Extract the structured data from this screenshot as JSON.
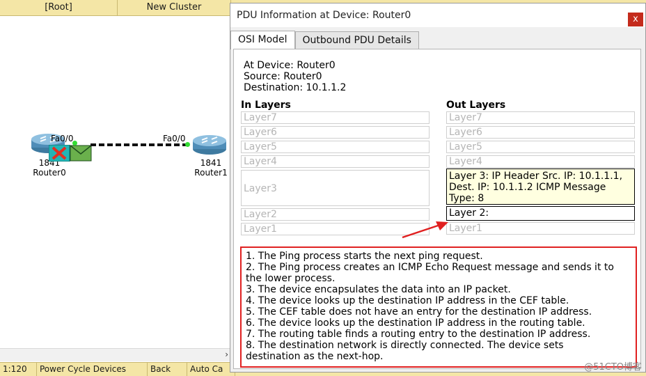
{
  "workspace": {
    "topbar": {
      "root": "[Root]",
      "new_cluster": "New Cluster"
    },
    "routers": [
      {
        "model": "1841",
        "name": "Router0",
        "port": "Fa0/0"
      },
      {
        "model": "1841",
        "name": "Router1",
        "port": "Fa0/0"
      }
    ],
    "bottombar": {
      "time": "1:120",
      "cycle": "Power Cycle Devices",
      "back": "Back",
      "auto": "Auto Ca"
    },
    "scroll_arrow": "›"
  },
  "dialog": {
    "title": "PDU Information at Device: Router0",
    "close": "x",
    "tabs": [
      {
        "label": "OSI Model",
        "active": true
      },
      {
        "label": "Outbound PDU Details",
        "active": false
      }
    ],
    "info": {
      "at_device": "At Device: Router0",
      "source": "Source: Router0",
      "destination": "Destination: 10.1.1.2"
    },
    "in_layers": {
      "header": "In Layers",
      "layer7": "Layer7",
      "layer6": "Layer6",
      "layer5": "Layer5",
      "layer4": "Layer4",
      "layer3": "Layer3",
      "layer2": "Layer2",
      "layer1": "Layer1"
    },
    "out_layers": {
      "header": "Out Layers",
      "layer7": "Layer7",
      "layer6": "Layer6",
      "layer5": "Layer5",
      "layer4": "Layer4",
      "layer3_line1": "Layer 3: IP Header Src. IP: 10.1.1.1,",
      "layer3_line2": "Dest. IP: 10.1.1.2 ICMP Message",
      "layer3_line3": "Type: 8",
      "layer2": "Layer 2:",
      "layer1": "Layer1"
    },
    "description": [
      "1. The Ping process starts the next ping request.",
      "2. The Ping process creates an ICMP Echo Request message and sends it to",
      "the lower process.",
      "3. The device encapsulates the data into an IP packet.",
      "4. The device looks up the destination IP address in the CEF table.",
      "5. The CEF table does not have an entry for the destination IP address.",
      "6. The device looks up the destination IP address in the routing table.",
      "7. The routing table finds a routing entry to the destination IP address.",
      "8. The destination network is directly connected. The device sets",
      "destination as the next-hop."
    ]
  },
  "watermark": "@51CTO博客",
  "colors": {
    "highlight_border": "#e02020",
    "layer3_bg": "#ffffe0",
    "topbar_bg": "#f4e6a6",
    "arrow": "#e02020"
  }
}
